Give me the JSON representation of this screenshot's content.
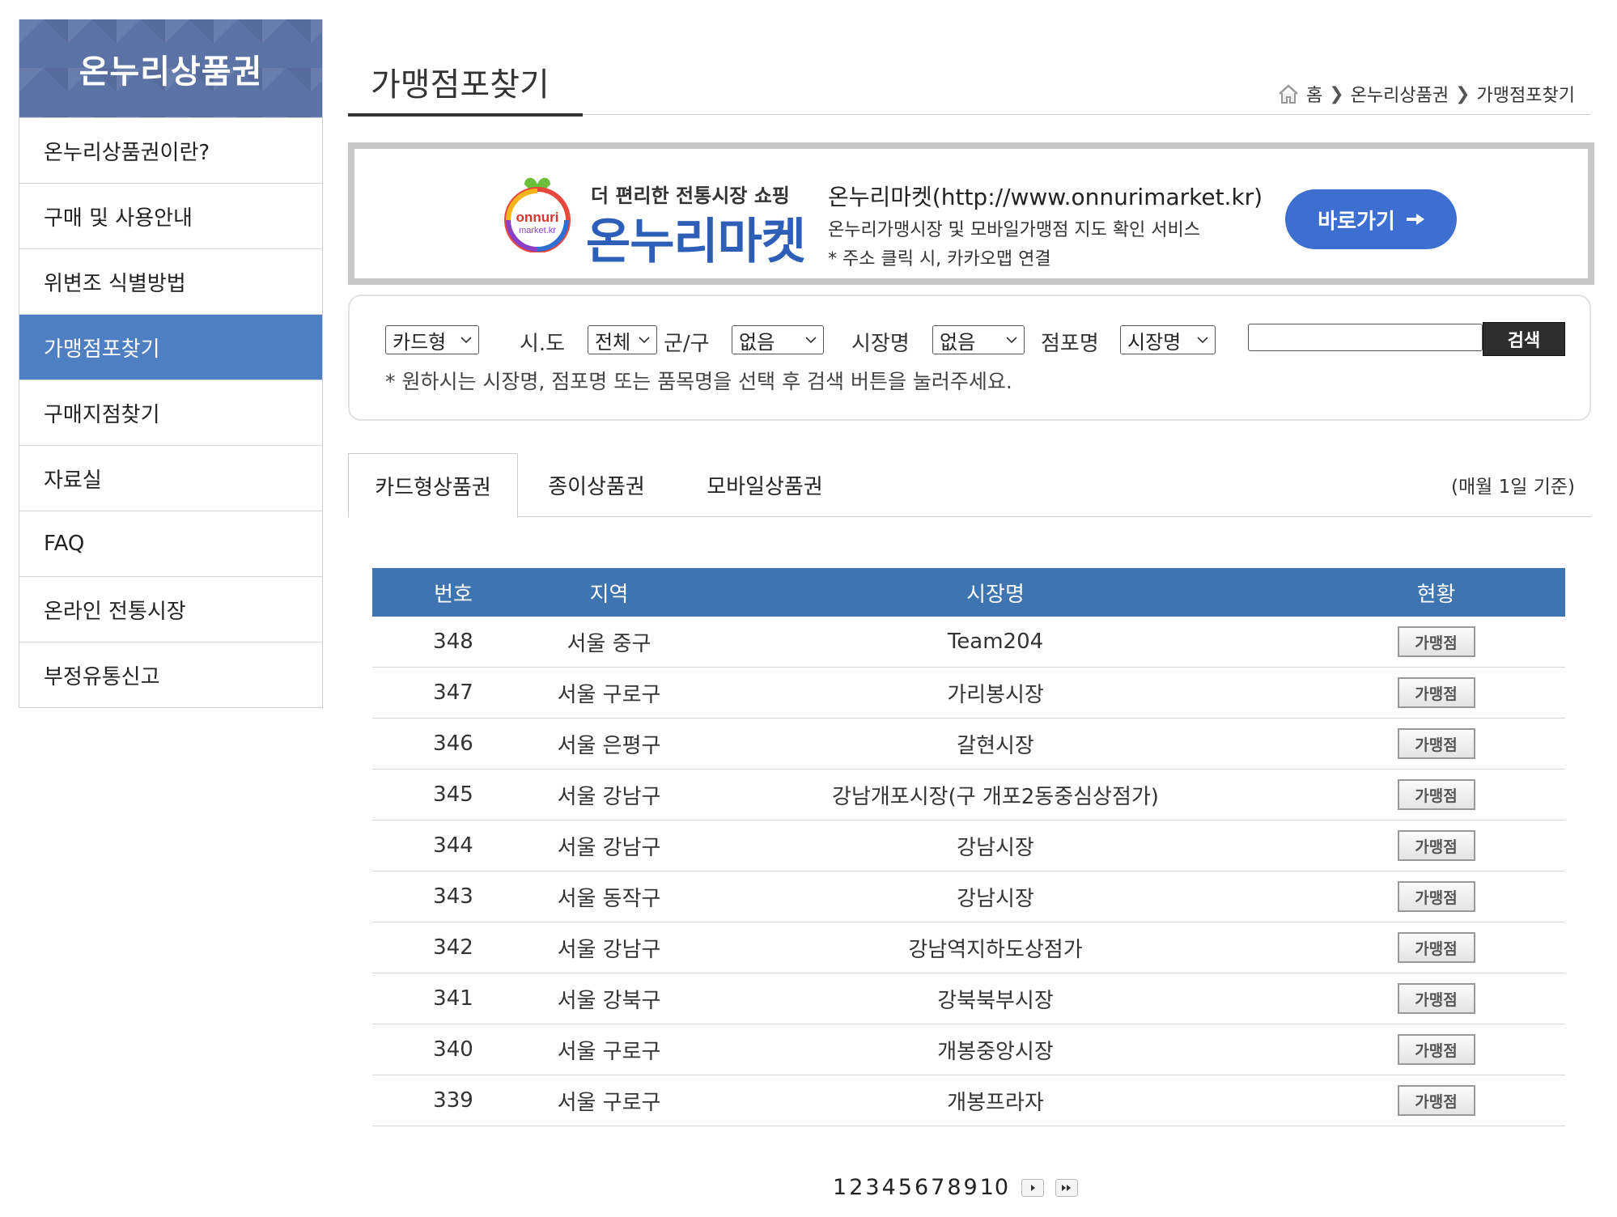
{
  "sidebar": {
    "title": "온누리상품권",
    "items": [
      {
        "label": "온누리상품권이란?"
      },
      {
        "label": "구매 및 사용안내"
      },
      {
        "label": "위변조 식별방법"
      },
      {
        "label": "가맹점포찾기"
      },
      {
        "label": "구매지점찾기"
      },
      {
        "label": "자료실"
      },
      {
        "label": "FAQ"
      },
      {
        "label": "온라인 전통시장"
      },
      {
        "label": "부정유통신고"
      }
    ],
    "active_item": "가맹점포찾기",
    "accent_color": "#4d7fc2"
  },
  "header": {
    "title": "가맹점포찾기",
    "breadcrumb": [
      "홈",
      "온누리상품권",
      "가맹점포찾기"
    ]
  },
  "banner": {
    "logo_text_1": "onnuri",
    "logo_text_2": "market.kr",
    "tagline": "더 편리한 전통시장 쇼핑",
    "brand": "온누리마켓",
    "url_text": "온누리마켓(http://www.onnurimarket.kr)",
    "desc": "온누리가맹시장 및 모바일가맹점 지도 확인 서비스",
    "note": "* 주소 클릭 시, 카카오맵 연결",
    "button_label": "바로가기"
  },
  "search": {
    "type_select": "카드형",
    "sido_label": "시.도",
    "sido_select": "전체",
    "gugun_label": "군/구",
    "gugun_select": "없음",
    "market_label": "시장명",
    "market_select": "없음",
    "store_label": "점포명",
    "store_select": "시장명",
    "input_value": "",
    "button_label": "검색",
    "help_text": "* 원하시는 시장명, 점포명 또는 품목명을 선택 후 검색 버튼을 눌러주세요."
  },
  "tabs": {
    "items": [
      {
        "label": "카드형상품권"
      },
      {
        "label": "종이상품권"
      },
      {
        "label": "모바일상품권"
      }
    ],
    "active": "카드형상품권",
    "note": "(매월 1일 기준)"
  },
  "table": {
    "headers": [
      "번호",
      "지역",
      "시장명",
      "현황"
    ],
    "header_color": "#3e74b0",
    "status_label": "가맹점",
    "rows": [
      {
        "no": "348",
        "region": "서울 중구",
        "market": "Team204"
      },
      {
        "no": "347",
        "region": "서울 구로구",
        "market": "가리봉시장"
      },
      {
        "no": "346",
        "region": "서울 은평구",
        "market": "갈현시장"
      },
      {
        "no": "345",
        "region": "서울 강남구",
        "market": "강남개포시장(구 개포2동중심상점가)"
      },
      {
        "no": "344",
        "region": "서울 강남구",
        "market": "강남시장"
      },
      {
        "no": "343",
        "region": "서울 동작구",
        "market": "강남시장"
      },
      {
        "no": "342",
        "region": "서울 강남구",
        "market": "강남역지하도상점가"
      },
      {
        "no": "341",
        "region": "서울 강북구",
        "market": "강북북부시장"
      },
      {
        "no": "340",
        "region": "서울 구로구",
        "market": "개봉중앙시장"
      },
      {
        "no": "339",
        "region": "서울 구로구",
        "market": "개봉프라자"
      }
    ]
  },
  "pagination": {
    "pages": [
      "1",
      "2",
      "3",
      "4",
      "5",
      "6",
      "7",
      "8",
      "9",
      "10"
    ],
    "current": "1"
  }
}
